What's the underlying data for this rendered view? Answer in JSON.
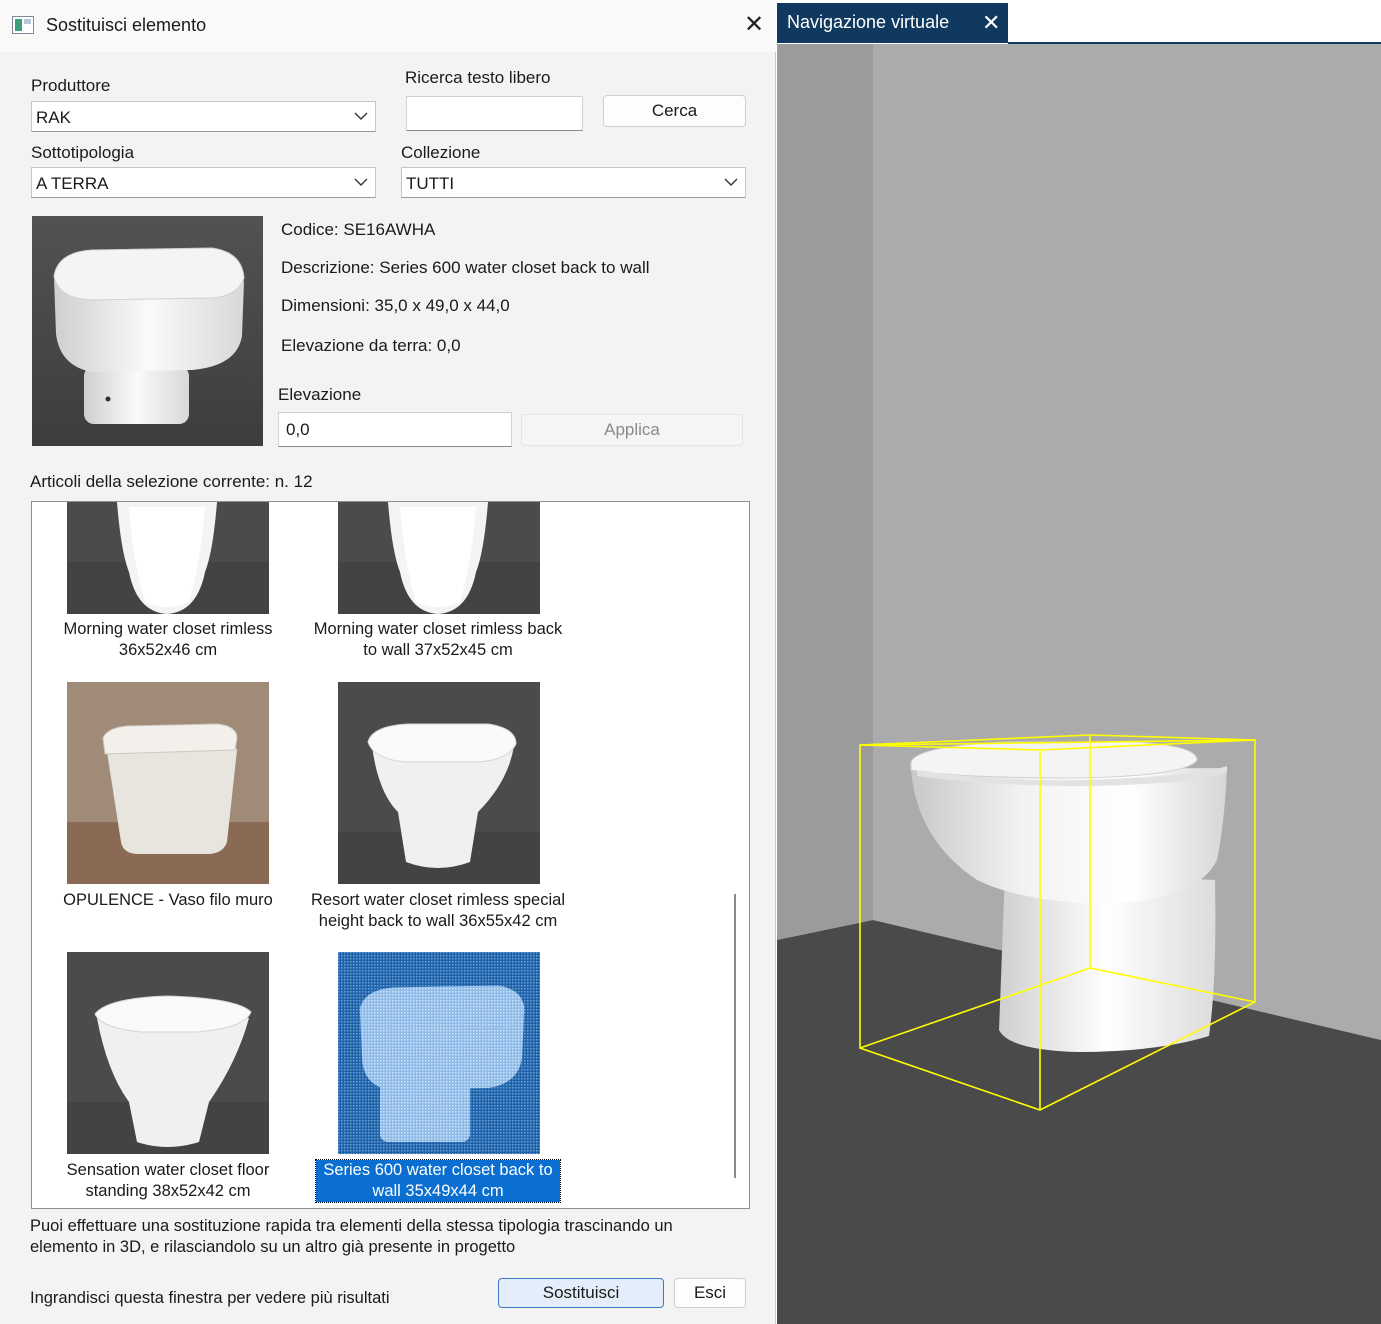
{
  "dialog": {
    "title": "Sostituisci elemento",
    "produttore_label": "Produttore",
    "produttore_value": "RAK",
    "ricerca_label": "Ricerca testo libero",
    "ricerca_value": "",
    "cerca_button": "Cerca",
    "sottotipologia_label": "Sottotipologia",
    "sottotipologia_value": "A TERRA",
    "collezione_label": "Collezione",
    "collezione_value": "TUTTI",
    "codice": "Codice: SE16AWHA",
    "descrizione": "Descrizione: Series 600 water closet back to wall",
    "dimensioni": "Dimensioni: 35,0 x 49,0 x 44,0",
    "elevazione_da_terra": "Elevazione da terra: 0,0",
    "elevazione_label": "Elevazione",
    "elevazione_value": "0,0",
    "applica_button": "Applica",
    "articoli_count": "Articoli della selezione corrente: n. 12",
    "items": [
      {
        "line1": "Morning water closet rimless",
        "line2": "36x52x46 cm"
      },
      {
        "line1": "Morning water closet rimless back",
        "line2": "to wall 37x52x45 cm"
      },
      {
        "line1": "OPULENCE - Vaso filo muro",
        "line2": ""
      },
      {
        "line1": "Resort water closet rimless special",
        "line2": "height back to wall 36x55x42 cm"
      },
      {
        "line1": "Sensation water closet floor",
        "line2": "standing 38x52x42 cm"
      },
      {
        "line1": "Series 600 water closet back to",
        "line2": "wall 35x49x44 cm"
      }
    ],
    "hint_line1": "Puoi effettuare una sostituzione rapida tra elementi della stessa tipologia trascinando un",
    "hint_line2": "elemento in 3D, e rilasciandolo su un altro già presente in progetto",
    "footer_hint": "Ingrandisci questa finestra per vedere più risultati",
    "sostituisci_button": "Sostituisci",
    "esci_button": "Esci"
  },
  "view3d": {
    "tab_label": "Navigazione virtuale",
    "tab_color": "#10395f",
    "selection_color": "#ffff00"
  },
  "colors": {
    "selected_item": "#0a6fd0",
    "primary_border": "#3b78c4"
  }
}
